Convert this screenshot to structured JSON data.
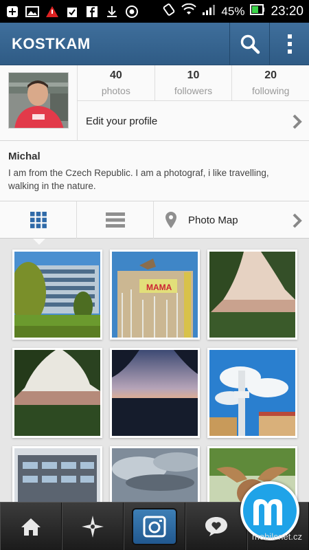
{
  "status_bar": {
    "battery": "45%",
    "time": "23:20"
  },
  "app_bar": {
    "title": "KOSTKAM"
  },
  "profile": {
    "stats": [
      {
        "value": "40",
        "label": "photos"
      },
      {
        "value": "10",
        "label": "followers"
      },
      {
        "value": "20",
        "label": "following"
      }
    ],
    "edit_label": "Edit your profile",
    "name": "Michal",
    "bio": "I am from the Czech Republic. I am a photograf, i like travelling, walking in the nature."
  },
  "tabs": {
    "grid_icon": "grid-icon",
    "list_icon": "list-icon",
    "map_label": "Photo Map"
  },
  "photos": [
    {
      "name": "glass-office-building"
    },
    {
      "name": "painted-building-birch-trees"
    },
    {
      "name": "city-view-through-trees"
    },
    {
      "name": "prague-castle-through-trees"
    },
    {
      "name": "sunset-silhouette"
    },
    {
      "name": "tv-tower-blue-sky"
    },
    {
      "name": "modern-building-facade"
    },
    {
      "name": "cloudy-sky"
    },
    {
      "name": "antelope-closeup"
    }
  ],
  "bottom_nav": [
    {
      "icon": "home-icon"
    },
    {
      "icon": "explore-star-icon"
    },
    {
      "icon": "camera-icon",
      "active": true
    },
    {
      "icon": "activity-heart-icon"
    },
    {
      "icon": "profile-icon"
    }
  ],
  "watermark": {
    "text": "mobilenet.cz"
  },
  "colors": {
    "app_bar": "#2f5b85",
    "accent": "#3d7fb6"
  }
}
